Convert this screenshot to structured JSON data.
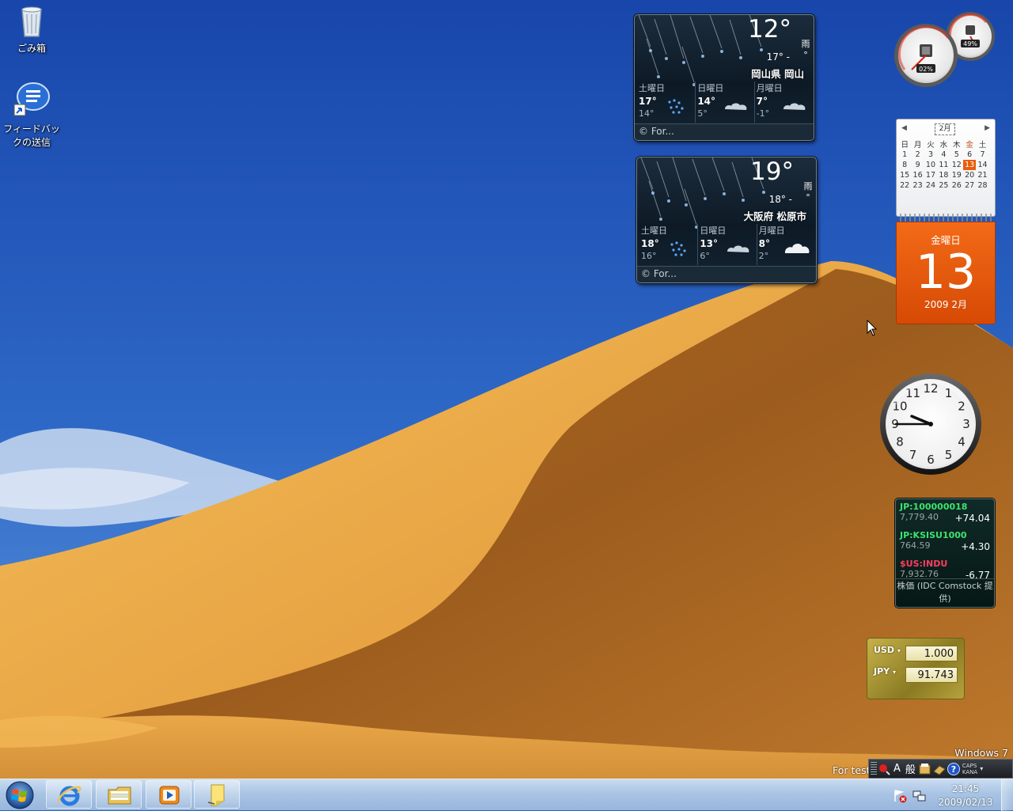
{
  "desktop": {
    "icons": [
      {
        "label": "ごみ箱",
        "icon": "recycle-bin-icon"
      },
      {
        "label": "フィードバックの送信",
        "icon": "feedback-icon"
      }
    ]
  },
  "weather": [
    {
      "temp": "12°",
      "condition": "雨",
      "deg": "°",
      "range": "17° -",
      "location": "岡山県 岡山",
      "days": [
        {
          "name": "土曜日",
          "hi": "17°",
          "lo": "14°",
          "icon": "rain-icon"
        },
        {
          "name": "日曜日",
          "hi": "14°",
          "lo": "5°",
          "icon": "cloud-icon"
        },
        {
          "name": "月曜日",
          "hi": "7°",
          "lo": "-1°",
          "icon": "cloud-icon"
        }
      ],
      "footer": "© For..."
    },
    {
      "temp": "19°",
      "condition": "雨",
      "deg": "°",
      "range": "18° -",
      "location": "大阪府 松原市",
      "days": [
        {
          "name": "土曜日",
          "hi": "18°",
          "lo": "16°",
          "icon": "rain-icon"
        },
        {
          "name": "日曜日",
          "hi": "13°",
          "lo": "6°",
          "icon": "cloud-icon"
        },
        {
          "name": "月曜日",
          "hi": "8°",
          "lo": "2°",
          "icon": "cloud-icon"
        }
      ],
      "footer": "© For..."
    }
  ],
  "cpu_meter": {
    "cpu": "02%",
    "memory": "49%"
  },
  "calendar": {
    "month_title": "2月",
    "weekdays": [
      "日",
      "月",
      "火",
      "水",
      "木",
      "金",
      "土"
    ],
    "weeks": [
      [
        "1",
        "2",
        "3",
        "4",
        "5",
        "6",
        "7"
      ],
      [
        "8",
        "9",
        "10",
        "11",
        "12",
        "13",
        "14"
      ],
      [
        "15",
        "16",
        "17",
        "18",
        "19",
        "20",
        "21"
      ],
      [
        "22",
        "23",
        "24",
        "25",
        "26",
        "27",
        "28"
      ]
    ],
    "today": "13",
    "weekday_label": "金曜日",
    "big_day": "13",
    "year_month": "2009 2月"
  },
  "clock": {
    "hour": 9,
    "minute": 45
  },
  "stocks": {
    "items": [
      {
        "symbol": "JP:100000018",
        "price": "7,779.40",
        "change": "+74.04",
        "direction": "up"
      },
      {
        "symbol": "JP:KSISU1000",
        "price": "764.59",
        "change": "+4.30",
        "direction": "up"
      },
      {
        "symbol": "$US:INDU",
        "price": "7,932.76",
        "change": "-6.77",
        "direction": "down"
      }
    ],
    "source": "株価 (IDC Comstock 提供)"
  },
  "currency": {
    "from": "USD",
    "to": "JPY",
    "from_value": "1.000",
    "to_value": "91.743"
  },
  "watermark": {
    "line1": "Windows 7",
    "line2": "For test"
  },
  "language_bar": {
    "mode": "A",
    "ime": "般",
    "caps": "CAPS",
    "kana": "KANA"
  },
  "taskbar": {
    "pinned": [
      {
        "name": "internet-explorer",
        "icon": "ie-icon"
      },
      {
        "name": "explorer",
        "icon": "folder-icon"
      },
      {
        "name": "media-player",
        "icon": "media-player-icon"
      },
      {
        "name": "sticky-notes",
        "icon": "sticky-note-icon"
      }
    ],
    "time": "21:45",
    "date": "2009/02/13"
  },
  "colors": {
    "sky_top": "#1a4fb0",
    "sky_bottom": "#4d86d6",
    "sand_light": "#f0b04a",
    "sand_shadow": "#a9661f",
    "calendar_accent": "#e85d0c",
    "stock_up": "#3fe26c",
    "stock_down": "#ff3d5e"
  }
}
